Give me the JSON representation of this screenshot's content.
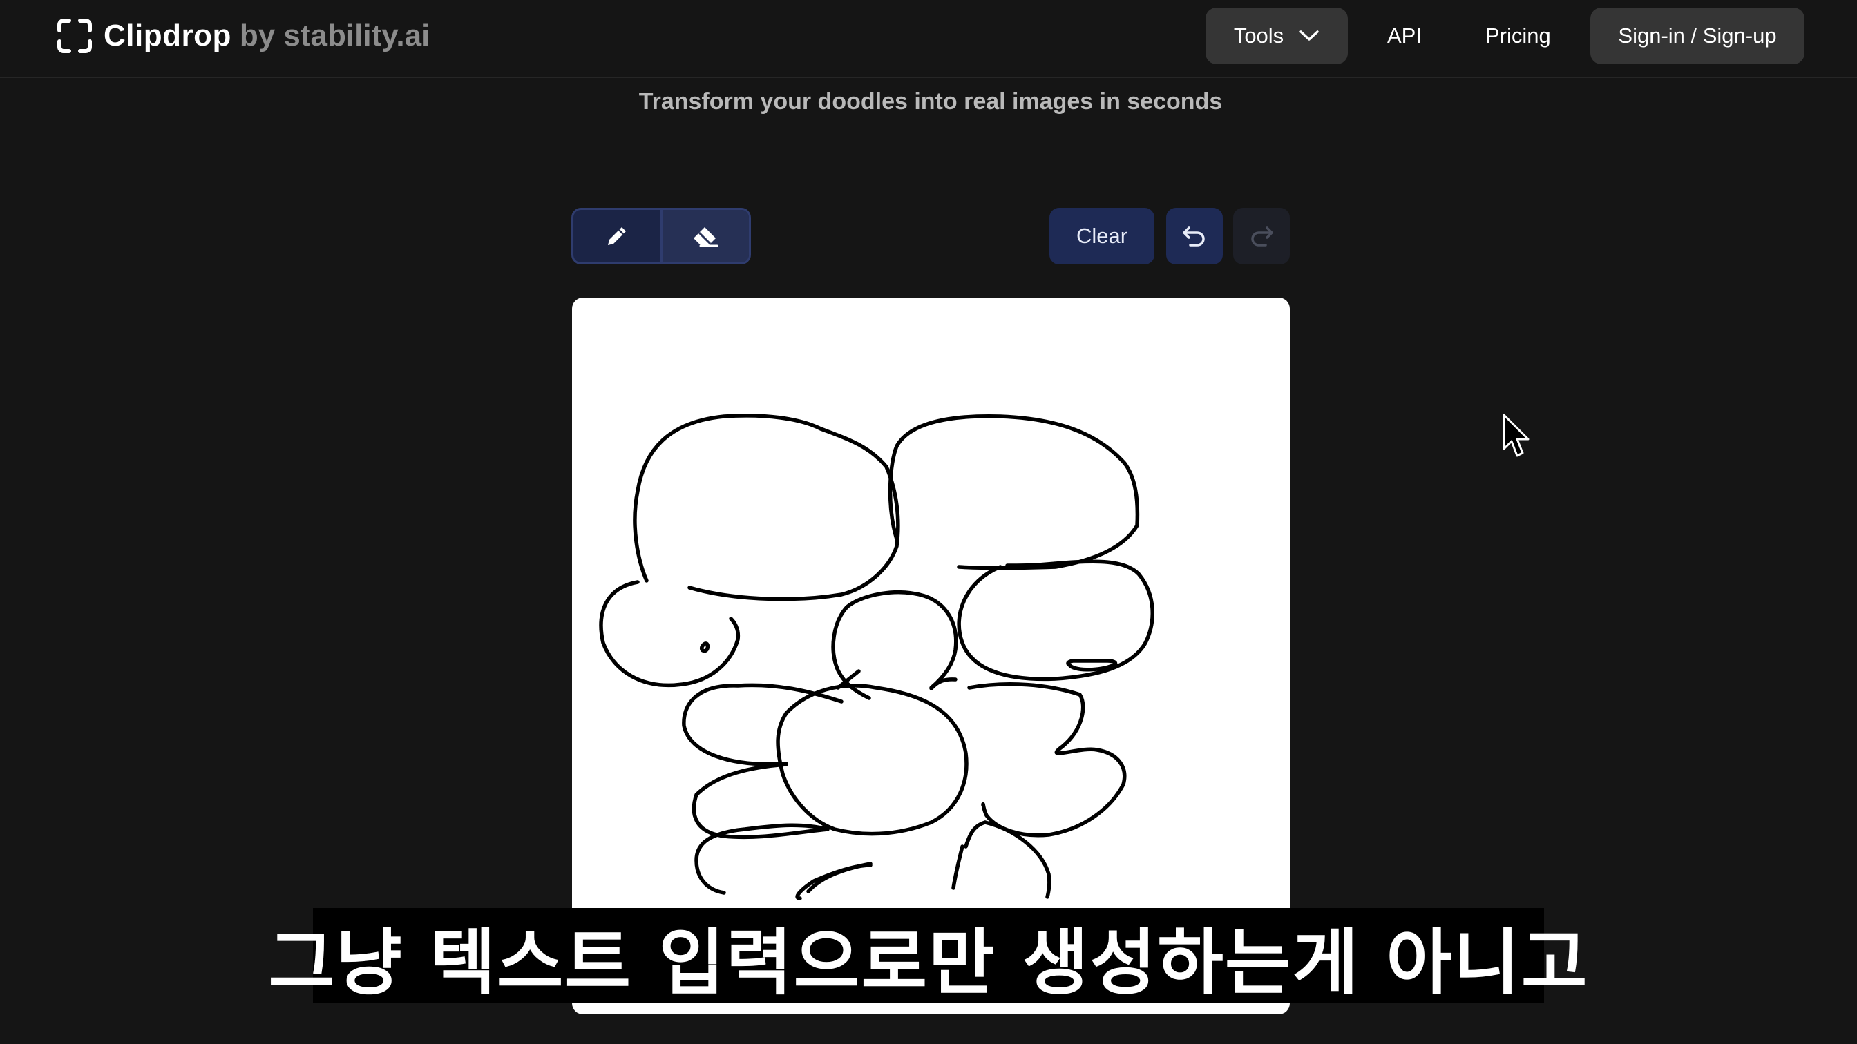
{
  "header": {
    "logo_name": "Clipdrop",
    "logo_by": "by stability.ai",
    "nav": {
      "tools_label": "Tools",
      "api_label": "API",
      "pricing_label": "Pricing",
      "signin_label": "Sign-in / Sign-up"
    }
  },
  "main": {
    "subtitle": "Transform your doodles into real images in seconds",
    "toolbar": {
      "pencil_icon": "pencil-icon",
      "eraser_icon": "eraser-icon",
      "clear_label": "Clear",
      "undo_icon": "undo-icon",
      "redo_icon": "redo-icon"
    }
  },
  "caption": {
    "text": "그냥 텍스트 입력으로만 생성하는게 아니고"
  },
  "colors": {
    "background": "#151515",
    "nav_button": "#353535",
    "toolbar_accent": "#1e2a55",
    "canvas": "#ffffff"
  }
}
